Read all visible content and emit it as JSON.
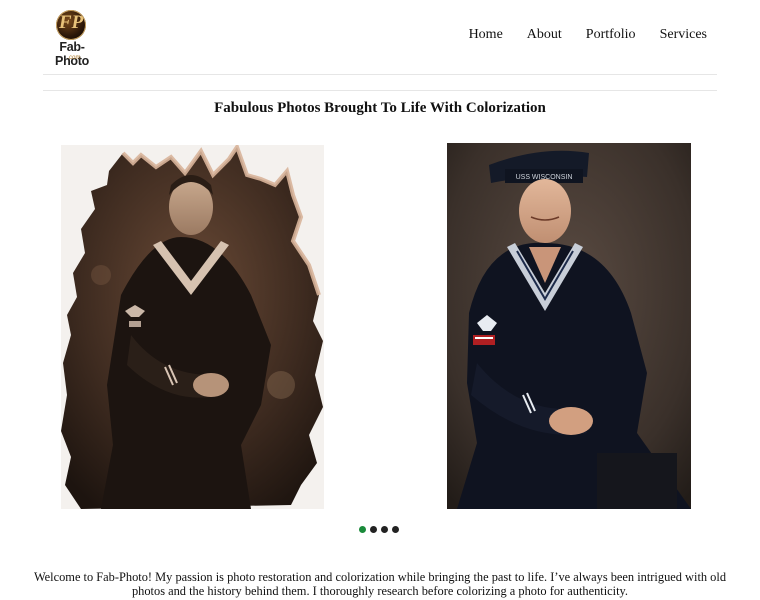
{
  "brand": {
    "monogram": "FP",
    "name": "Fab-Photo",
    "suffix": ".com"
  },
  "nav": {
    "items": [
      {
        "label": "Home"
      },
      {
        "label": "About"
      },
      {
        "label": "Portfolio"
      },
      {
        "label": "Services"
      }
    ]
  },
  "hero": {
    "headline": "Fabulous Photos Brought To Life With Colorization",
    "before_photo_icon": "sepia-damaged-sailor-portrait",
    "after_photo_icon": "colorized-sailor-portrait",
    "cap_text": "USS WISCONSIN"
  },
  "carousel": {
    "slide_count": 4,
    "active_index": 0,
    "active_color": "#1a8a3a",
    "inactive_color": "#222222"
  },
  "intro": {
    "text": "Welcome to Fab-Photo! My passion is photo restoration and colorization while bringing the past to life. I’ve always been intrigued with old photos and the history behind them. I thoroughly research before colorizing a photo for authenticity."
  }
}
